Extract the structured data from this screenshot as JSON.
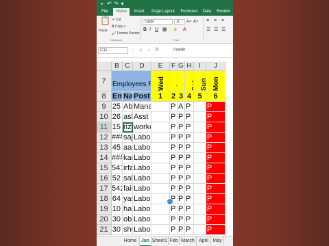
{
  "ribbon_tabs": [
    "File",
    "Home",
    "Insert",
    "Page Layout",
    "Formulas",
    "Data",
    "Review"
  ],
  "active_tab": "Home",
  "clipboard": {
    "paste": "Paste",
    "cut": "Cut",
    "copy": "Copy",
    "format_painter": "Format Painter",
    "group": "Clipboard"
  },
  "font": {
    "name": "Calibri",
    "size": "11",
    "group": "Font"
  },
  "name_box": "C11",
  "formula_value": "rizwan",
  "columns": [
    "B",
    "C",
    "D",
    "E",
    "F",
    "G",
    "H",
    "I",
    "J"
  ],
  "day_row": {
    "row": "7",
    "title": "Employees Record",
    "days": [
      "Wed",
      "Thu",
      "Fri",
      "Sat",
      "Sun",
      "Mon"
    ]
  },
  "header_row": {
    "row": "8",
    "emp": "Emp",
    "name": "Nam",
    "post": "Post",
    "nums": [
      "1",
      "2",
      "3",
      "4",
      "5",
      "6"
    ]
  },
  "rows": [
    {
      "row": "9",
      "id": "25",
      "name": "Abid",
      "post": "Manager",
      "att": [
        "P",
        "A",
        "P",
        "",
        "P"
      ]
    },
    {
      "row": "10",
      "id": "26",
      "name": "aslam",
      "post": "Asst",
      "att": [
        "P",
        "P",
        "P",
        "",
        "P"
      ]
    },
    {
      "row": "11",
      "id": "15",
      "name": "rizwa",
      "post": "worker",
      "att": [
        "P",
        "P",
        "P",
        "",
        "P"
      ]
    },
    {
      "row": "12",
      "id": "###",
      "name": "sajid",
      "post": "Labour",
      "att": [
        "P",
        "P",
        "P",
        "",
        "P"
      ]
    },
    {
      "row": "13",
      "id": "45",
      "name": "aami",
      "post": "Labour",
      "att": [
        "P",
        "P",
        "P",
        "",
        "P"
      ]
    },
    {
      "row": "14",
      "id": "###",
      "name": "kamr",
      "post": "Labour",
      "att": [
        "P",
        "P",
        "P",
        "",
        "P"
      ]
    },
    {
      "row": "15",
      "id": "541",
      "name": "irfan",
      "post": "Labour",
      "att": [
        "P",
        "P",
        "P",
        "",
        "P"
      ]
    },
    {
      "row": "16",
      "id": "52",
      "name": "sabir",
      "post": "Labour",
      "att": [
        "P",
        "P",
        "P",
        "",
        "P"
      ]
    },
    {
      "row": "17",
      "id": "542",
      "name": "faisal",
      "post": "Labour",
      "att": [
        "P",
        "P",
        "P",
        "",
        "P"
      ]
    },
    {
      "row": "18",
      "id": "64",
      "name": "yasir",
      "post": "Labour",
      "att": [
        "P",
        "P",
        "P",
        "",
        "P"
      ]
    },
    {
      "row": "19",
      "id": "10",
      "name": "hake",
      "post": "Labour",
      "att": [
        "P",
        "P",
        "P",
        "",
        "P"
      ]
    },
    {
      "row": "20",
      "id": "30",
      "name": "obaid",
      "post": "Labour",
      "att": [
        "P",
        "P",
        "P",
        "",
        "P"
      ]
    },
    {
      "row": "21",
      "id": "30",
      "name": "shuk",
      "post": "Labour",
      "att": [
        "P",
        "P",
        "P",
        "",
        "P"
      ]
    }
  ],
  "sheet_tabs": [
    "Home",
    "Jan",
    "Sheet1",
    "Feb",
    "March",
    "April",
    "May"
  ],
  "active_sheet": "Jan",
  "colors": {
    "excel_green": "#217346",
    "header_blue": "#8db4e2",
    "day_yellow": "#ffff00",
    "sunday_red": "#ff0000"
  }
}
